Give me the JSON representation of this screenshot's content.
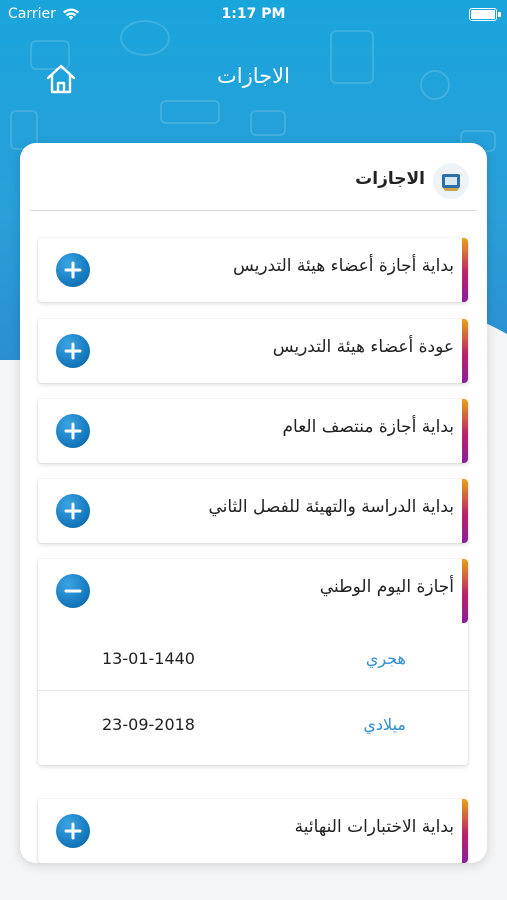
{
  "status": {
    "carrier": "Carrier",
    "time": "1:17 PM"
  },
  "nav": {
    "title": "الاجازات"
  },
  "card": {
    "title": "الاجازات"
  },
  "items": [
    {
      "label": "بداية أجازة أعضاء هيئة التدريس"
    },
    {
      "label": "عودة أعضاء هيئة التدريس"
    },
    {
      "label": "بداية أجازة منتصف العام"
    },
    {
      "label": "بداية الدراسة والتهيئة للفصل الثاني"
    },
    {
      "label": "أجازة اليوم الوطني",
      "details": [
        {
          "key": "هجري",
          "value": "13-01-1440"
        },
        {
          "key": "ميلادي",
          "value": "23-09-2018"
        }
      ]
    },
    {
      "label": "بداية الاختبارات النهائية"
    }
  ],
  "colors": {
    "accent": "#1e8fd5",
    "bar_top": "#e8a21a",
    "bar_bottom": "#8a1e9a"
  }
}
